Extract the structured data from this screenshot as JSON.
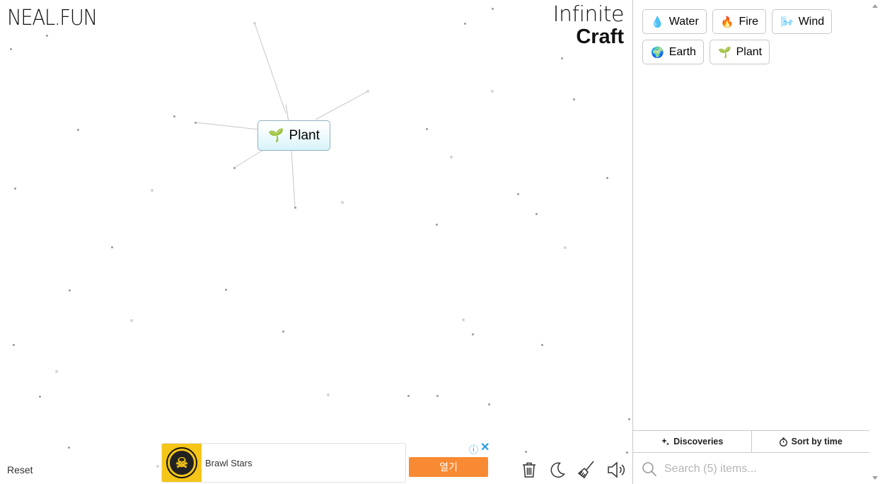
{
  "brand": {
    "left_logo": "NEAL.FUN",
    "title_line1": "Infinite",
    "title_line2": "Craft"
  },
  "canvas": {
    "item": {
      "emoji": "🌱",
      "label": "Plant"
    },
    "reset_label": "Reset"
  },
  "ad": {
    "app_name": "Brawl Stars",
    "button_label": "열기",
    "info_icon": "ⓘ",
    "close_icon": "✕"
  },
  "toolbar": {
    "trash": "trash-icon",
    "dark_mode": "moon-icon",
    "clear": "broom-icon",
    "sound": "speaker-icon"
  },
  "sidebar": {
    "items": [
      {
        "emoji": "💧",
        "label": "Water"
      },
      {
        "emoji": "🔥",
        "label": "Fire"
      },
      {
        "emoji": "🌬️",
        "label": "Wind"
      },
      {
        "emoji": "🌍",
        "label": "Earth"
      },
      {
        "emoji": "🌱",
        "label": "Plant"
      }
    ],
    "tabs": {
      "discoveries": "Discoveries",
      "sort": "Sort by time"
    },
    "search_placeholder": "Search (5) items..."
  }
}
